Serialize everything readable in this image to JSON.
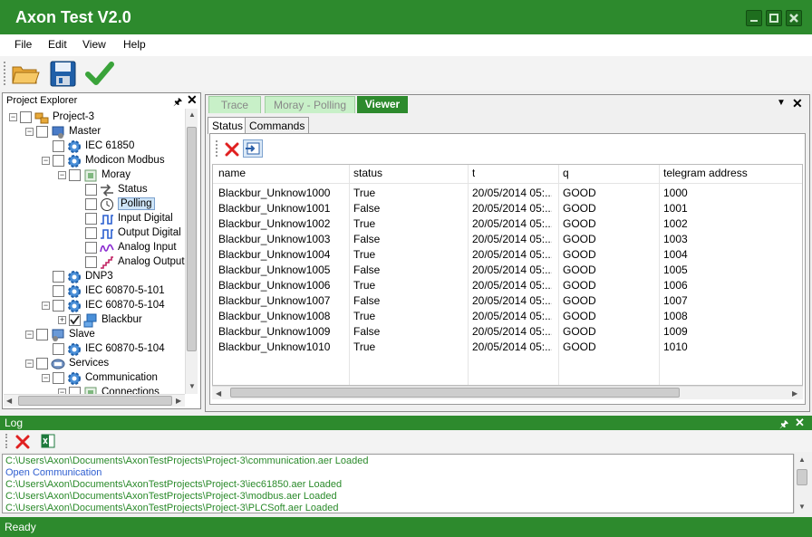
{
  "app": {
    "title": "Axon Test V2.0"
  },
  "menu": [
    "File",
    "Edit",
    "View",
    "Help"
  ],
  "toolbar": {
    "icons": [
      "open-folder-icon",
      "save-icon",
      "checkmark-icon"
    ]
  },
  "explorer": {
    "title": "Project Explorer",
    "tree": [
      {
        "label": "Project-3",
        "icon": "project-icon",
        "depth": 0,
        "exp": "-"
      },
      {
        "label": "Master",
        "icon": "master-icon",
        "depth": 1,
        "exp": "-"
      },
      {
        "label": "IEC 61850",
        "icon": "gear-icon",
        "depth": 2,
        "exp": ""
      },
      {
        "label": "Modicon Modbus",
        "icon": "gear-icon",
        "depth": 2,
        "exp": "-"
      },
      {
        "label": "Moray",
        "icon": "device-icon",
        "depth": 3,
        "exp": "-"
      },
      {
        "label": "Status",
        "icon": "status-icon",
        "depth": 4,
        "exp": ""
      },
      {
        "label": "Polling",
        "icon": "clock-icon",
        "depth": 4,
        "exp": "",
        "selected": true
      },
      {
        "label": "Input Digital",
        "icon": "digital-icon",
        "depth": 4,
        "exp": ""
      },
      {
        "label": "Output Digital",
        "icon": "digital-icon",
        "depth": 4,
        "exp": ""
      },
      {
        "label": "Analog Input",
        "icon": "analog-icon",
        "depth": 4,
        "exp": ""
      },
      {
        "label": "Analog Output",
        "icon": "analog-output-icon",
        "depth": 4,
        "exp": ""
      },
      {
        "label": "DNP3",
        "icon": "gear-icon",
        "depth": 2,
        "exp": ""
      },
      {
        "label": "IEC 60870-5-101",
        "icon": "gear-icon",
        "depth": 2,
        "exp": ""
      },
      {
        "label": "IEC 60870-5-104",
        "icon": "gear-icon",
        "depth": 2,
        "exp": "-"
      },
      {
        "label": "Blackbur",
        "icon": "network-icon",
        "depth": 3,
        "exp": "+",
        "checked": true
      },
      {
        "label": "Slave",
        "icon": "slave-icon",
        "depth": 1,
        "exp": "-"
      },
      {
        "label": "IEC 60870-5-104",
        "icon": "gear-icon",
        "depth": 2,
        "exp": ""
      },
      {
        "label": "Services",
        "icon": "services-icon",
        "depth": 1,
        "exp": "-"
      },
      {
        "label": "Communication",
        "icon": "gear-icon",
        "depth": 2,
        "exp": "-"
      },
      {
        "label": "Connections",
        "icon": "device-icon",
        "depth": 3,
        "exp": "-"
      }
    ]
  },
  "doctabs": [
    "Trace",
    "Moray - Polling",
    "Viewer"
  ],
  "subtabs": [
    "Status",
    "Commands"
  ],
  "grid": {
    "columns": [
      "name",
      "status",
      "t",
      "q",
      "telegram address"
    ],
    "rows": [
      [
        "Blackbur_Unknow1000",
        "True",
        "20/05/2014 05:...",
        "GOOD",
        "1000"
      ],
      [
        "Blackbur_Unknow1001",
        "False",
        "20/05/2014 05:...",
        "GOOD",
        "1001"
      ],
      [
        "Blackbur_Unknow1002",
        "True",
        "20/05/2014 05:...",
        "GOOD",
        "1002"
      ],
      [
        "Blackbur_Unknow1003",
        "False",
        "20/05/2014 05:...",
        "GOOD",
        "1003"
      ],
      [
        "Blackbur_Unknow1004",
        "True",
        "20/05/2014 05:...",
        "GOOD",
        "1004"
      ],
      [
        "Blackbur_Unknow1005",
        "False",
        "20/05/2014 05:...",
        "GOOD",
        "1005"
      ],
      [
        "Blackbur_Unknow1006",
        "True",
        "20/05/2014 05:...",
        "GOOD",
        "1006"
      ],
      [
        "Blackbur_Unknow1007",
        "False",
        "20/05/2014 05:...",
        "GOOD",
        "1007"
      ],
      [
        "Blackbur_Unknow1008",
        "True",
        "20/05/2014 05:...",
        "GOOD",
        "1008"
      ],
      [
        "Blackbur_Unknow1009",
        "False",
        "20/05/2014 05:...",
        "GOOD",
        "1009"
      ],
      [
        "Blackbur_Unknow1010",
        "True",
        "20/05/2014 05:...",
        "GOOD",
        "1010"
      ]
    ]
  },
  "log": {
    "title": "Log",
    "lines": [
      {
        "text": "C:\\Users\\Axon\\Documents\\AxonTestProjects\\Project-3\\communication.aer Loaded",
        "color": "#2a8a2a"
      },
      {
        "text": "Open Communication",
        "color": "#2f5fd0"
      },
      {
        "text": "C:\\Users\\Axon\\Documents\\AxonTestProjects\\Project-3\\iec61850.aer Loaded",
        "color": "#2a8a2a"
      },
      {
        "text": "C:\\Users\\Axon\\Documents\\AxonTestProjects\\Project-3\\modbus.aer Loaded",
        "color": "#2a8a2a"
      },
      {
        "text": "C:\\Users\\Axon\\Documents\\AxonTestProjects\\Project-3\\PLCSoft.aer Loaded",
        "color": "#2a8a2a"
      }
    ]
  },
  "status": {
    "text": "Ready"
  },
  "colors": {
    "brand": "#2d8a2d",
    "selection": "#cde4f7"
  }
}
